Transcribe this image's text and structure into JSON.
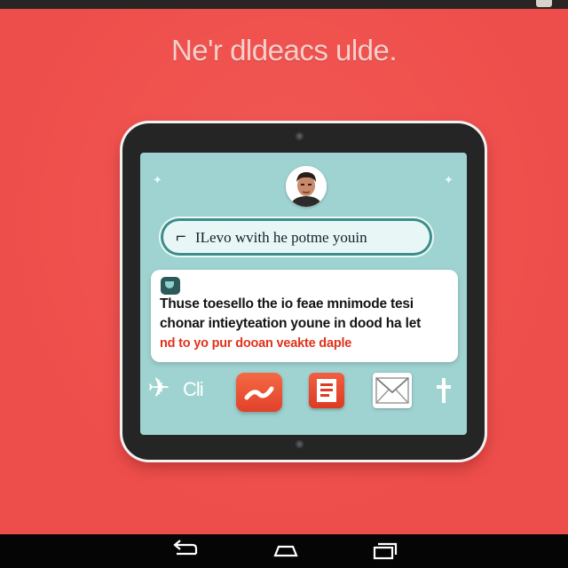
{
  "screen": {
    "title": "Ne'r dldeacs ulde.",
    "colors": {
      "background": "#ee4e4b",
      "tablet_frame": "#252526",
      "tablet_screen": "#9fd3d1",
      "accent_teal": "#3d8e8a",
      "accent_red_text": "#e1321c"
    }
  },
  "tablet": {
    "search": {
      "icon": "quote-mark-icon",
      "text": "ILevo wvith he potme youin"
    },
    "message": {
      "icon": "chat-app-icon",
      "lines": [
        "Thuse toesello the io feae mnimode tesi",
        "chonar intieyteation youne in dood ha let",
        "nd to yo pur dooan veakte daple"
      ]
    },
    "apps": {
      "plane_icon": "airplane-icon",
      "cli_label": "Cli",
      "red_app_icon": "red-chart-app-icon",
      "doc_app_icon": "document-app-icon",
      "mail_app_icon": "mail-envelope-icon",
      "arrow_icon": "up-arrow-icon"
    }
  },
  "nav": {
    "back_icon": "back-arrow-icon",
    "home_icon": "home-icon",
    "recents_icon": "recent-apps-icon"
  }
}
